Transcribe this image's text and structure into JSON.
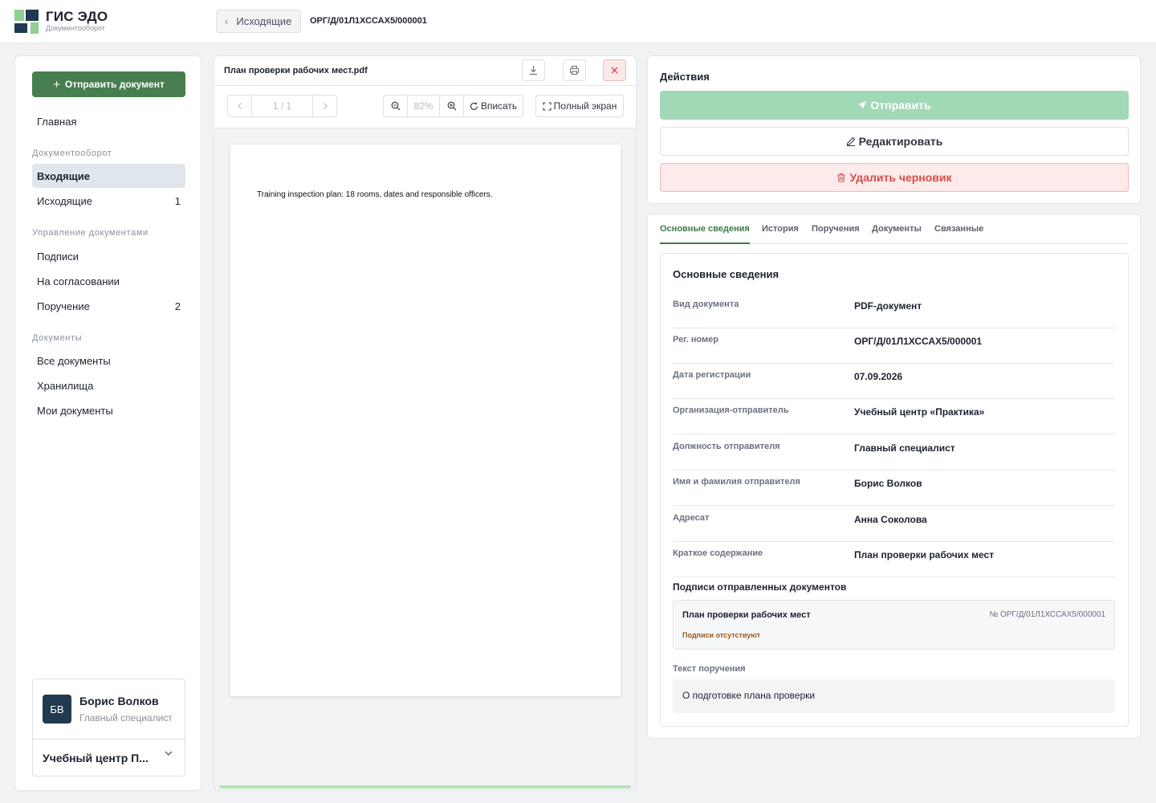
{
  "app": {
    "title": "ГИС ЭДО",
    "subtitle": "Документооборот"
  },
  "header": {
    "back_label": "Исходящие",
    "doc_number": "ОРГ/Д/01Л1ХССАХ5/000001"
  },
  "sidebar": {
    "send_label": "Отправить документ",
    "home_label": "Главная",
    "sections": [
      {
        "title": "Документооборот"
      },
      {
        "title": "Управление документами"
      },
      {
        "title": "Документы"
      }
    ],
    "items": [
      {
        "label": "Входящие",
        "count": ""
      },
      {
        "label": "Исходящие",
        "count": "1"
      },
      {
        "label": "Подписи",
        "count": ""
      },
      {
        "label": "На согласовании",
        "count": ""
      },
      {
        "label": "Поручение",
        "count": "2"
      },
      {
        "label": "Все документы",
        "count": ""
      },
      {
        "label": "Хранилища",
        "count": ""
      },
      {
        "label": "Мои документы",
        "count": ""
      }
    ],
    "active_item": "Входящие",
    "user": {
      "initials": "БВ",
      "name": "Борис Волков",
      "role": "Главный специалист",
      "org": "Учебный центр П..."
    }
  },
  "viewer": {
    "file_name": "План проверки рабочих мест.pdf",
    "page_indicator": "1 / 1",
    "zoom": "82%",
    "fit_label": "Вписать",
    "fullscreen_label": "Полный экран",
    "page_text": "Training inspection plan: 18 rooms, dates and responsible officers.",
    "progress": 1.0
  },
  "actions": {
    "title": "Действия",
    "send_label": "Отправить",
    "edit_label": "Редактировать",
    "delete_label": "Удалить черновик"
  },
  "tabs": [
    {
      "label": "Основные сведения"
    },
    {
      "label": "История"
    },
    {
      "label": "Поручения"
    },
    {
      "label": "Документы"
    },
    {
      "label": "Связанные"
    }
  ],
  "active_tab": "Основные сведения",
  "details": {
    "title": "Основные сведения",
    "rows": [
      {
        "label": "Вид документа",
        "value": "PDF-документ"
      },
      {
        "label": "Рег. номер",
        "value": "ОРГ/Д/01Л1ХССАХ5/000001"
      },
      {
        "label": "Дата регистрации",
        "value": "07.09.2026"
      },
      {
        "label": "Организация-отправитель",
        "value": "Учебный центр «Практика»"
      },
      {
        "label": "Должность отправителя",
        "value": "Главный специалист"
      },
      {
        "label": "Имя и фамилия отправителя",
        "value": "Борис Волков"
      },
      {
        "label": "Адресат",
        "value": "Анна Соколова"
      },
      {
        "label": "Краткое содержание",
        "value": "План проверки рабочих мест"
      }
    ],
    "signatures": {
      "title": "Подписи отправленных документов",
      "doc_name": "План проверки рабочих мест",
      "doc_number": "№ ОРГ/Д/01Л1ХССАХ5/000001",
      "status": "Подписи отсутствуют"
    },
    "task": {
      "label": "Текст поручения",
      "text": "О подготовке плана проверки"
    }
  },
  "colors": {
    "accent": "#477e4f",
    "send_disabled": "#a1d8b6",
    "danger": "#d2504b",
    "active_tab": "#3f7a48",
    "avatar_bg": "#223a50"
  }
}
